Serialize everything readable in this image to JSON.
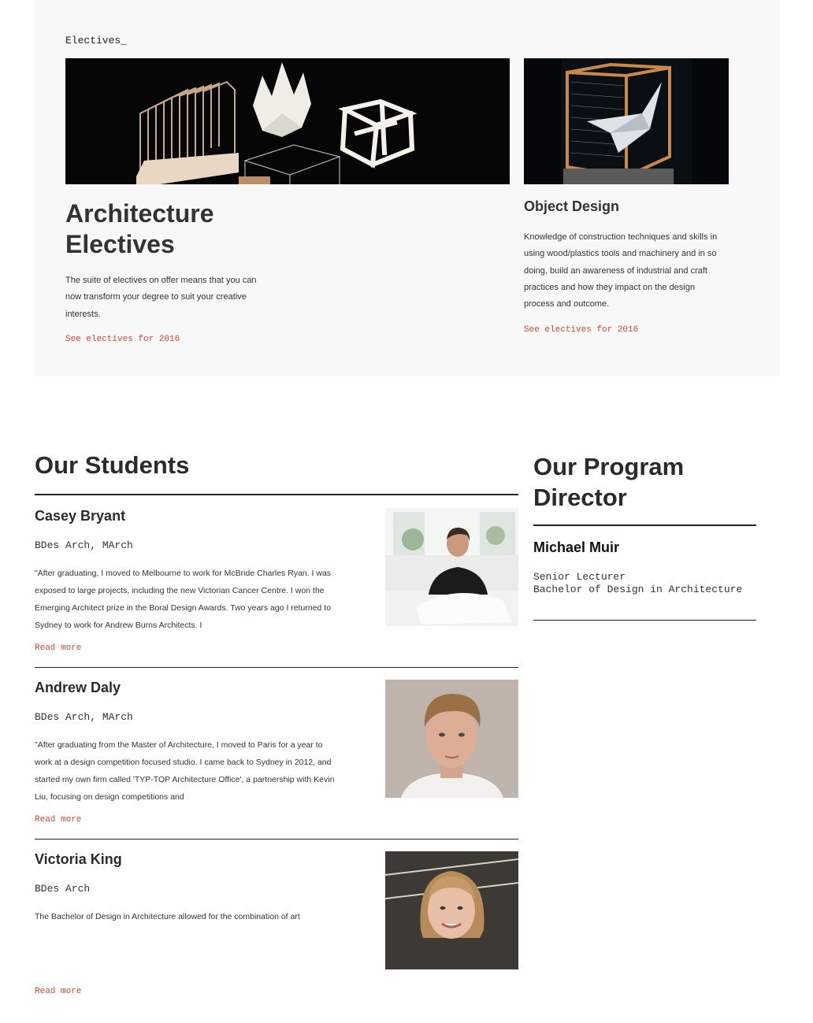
{
  "electives": {
    "tag": "Electives_",
    "architecture": {
      "image_alt": "Architectural models",
      "title_line1": "Architecture",
      "title_line2": "Electives",
      "description": "The suite of electives on offer means that you can now transform your degree to suit your creative interests.",
      "link": "See electives for 2016"
    },
    "object_design": {
      "image_alt": "Object design model in frame",
      "title": "Object Design",
      "description": "Knowledge of construction techniques and skills in using wood/plastics tools and machinery and in so doing, build an awareness of industrial and craft practices and how they impact on the design process and outcome.",
      "link": "See electives for 2016"
    }
  },
  "students": {
    "heading": "Our Students",
    "items": [
      {
        "name": "Casey Bryant",
        "degree": "BDes Arch, MArch",
        "quote": "\"After graduating, I moved to Melbourne to work for McBride Charles Ryan. I was exposed to large projects, including the new Victorian Cancer Centre. I won the Emerging Architect prize in the Boral Design Awards. Two years ago I returned to Sydney to work for Andrew Burns Architects. I",
        "read_more": "Read more"
      },
      {
        "name": "Andrew Daly",
        "degree": "BDes Arch, MArch",
        "quote": "\"After graduating from the Master of Architecture, I moved to Paris for a year to work at a design competition focused studio. I came back to Sydney in 2012, and started my own firm called 'TYP-TOP Architecture Office', a partnership with Kevin Liu, focusing on design competitions and",
        "read_more": "Read more"
      },
      {
        "name": "Victoria King",
        "degree": "BDes Arch",
        "quote": "The Bachelor of Design in Architecture allowed for the combination of art",
        "read_more": "Read more"
      }
    ]
  },
  "director": {
    "heading_line1": "Our Program",
    "heading_line2": "Director",
    "name": "Michael Muir",
    "role_line1": "Senior Lecturer",
    "role_line2": "Bachelor of Design in Architecture"
  },
  "colors": {
    "accent_link": "#d9482b",
    "panel_bg": "#f8f8f8",
    "text": "#2b2b2b"
  }
}
